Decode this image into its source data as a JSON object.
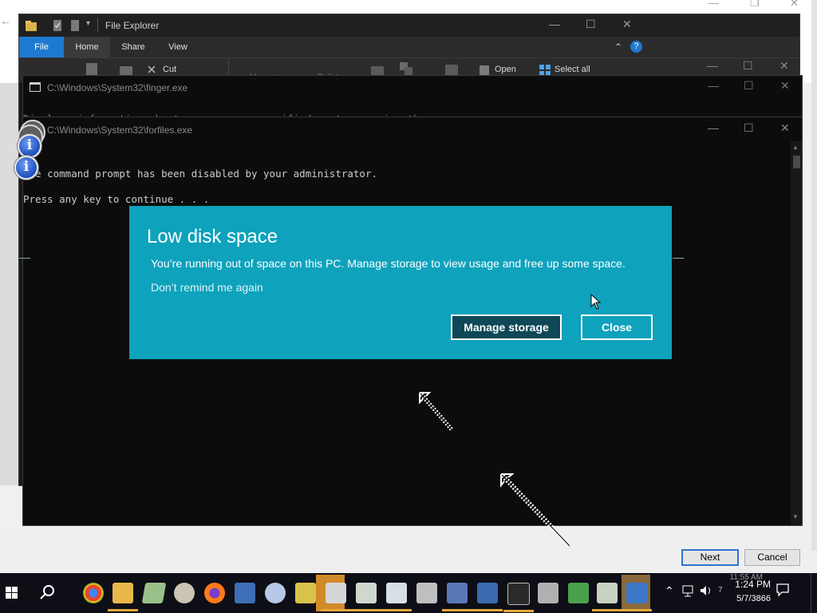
{
  "background_installer": {
    "next_label": "Next",
    "cancel_label": "Cancel"
  },
  "explorer": {
    "title": "File Explorer",
    "tabs": [
      "File",
      "Home",
      "Share",
      "View"
    ],
    "ribbon": {
      "cut": "Cut",
      "move_to": "Move to",
      "delete": "Delete",
      "open": "Open",
      "select_all": "Select all"
    }
  },
  "finger_window": {
    "title": "C:\\Windows\\System32\\finger.exe",
    "partial_text": "Displays information about a user on a specified system running the"
  },
  "console_window": {
    "title": "C:\\Windows\\System32\\forfiles.exe",
    "lines": [
      "The command prompt has been disabled by your administrator.",
      "Press any key to continue . . ."
    ]
  },
  "toast": {
    "title": "Low disk space",
    "message": "You’re running out of space on this PC. Manage storage to view usage and free up some space.",
    "dismiss_link": "Don’t remind me again",
    "primary_button": "Manage storage",
    "secondary_button": "Close",
    "background_color": "#0ea2bc"
  },
  "taskbar": {
    "apps": [
      "windows-start-icon",
      "search-icon",
      "chrome-icon",
      "file-explorer-icon",
      "notepad-icon",
      "paint-icon",
      "firefox-icon",
      "remote-desktop-icon",
      "app-icon",
      "network-tool-icon",
      "calculator-icon",
      "window-app-icon",
      "window-app-2-icon",
      "app-3-icon",
      "app-4-icon",
      "app-5-icon",
      "cmd-icon",
      "printer-icon",
      "game-icon",
      "app-6-icon",
      "display-icon"
    ],
    "time_ghost": "11:55 AM",
    "time": "1:24 PM",
    "date": "5/7/3866",
    "seven": "7"
  }
}
